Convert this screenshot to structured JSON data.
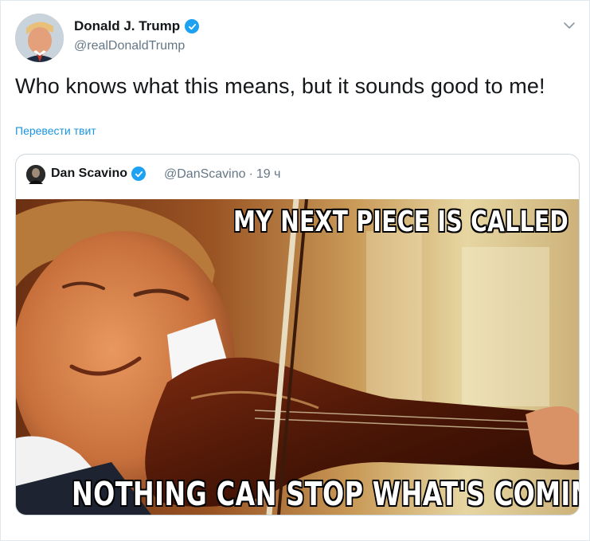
{
  "author": {
    "name": "Donald J. Trump",
    "handle": "@realDonaldTrump",
    "verified": true
  },
  "tweet": {
    "text": "Who knows what this means, but it sounds good to me!",
    "translate_label": "Перевести твит"
  },
  "menu": {
    "icon": "chevron-down-icon"
  },
  "quoted_tweet": {
    "name": "Dan Scavino",
    "handle": "@DanScavino",
    "separator": "·",
    "time": "19 ч",
    "verified": true,
    "media": {
      "top_text": "MY NEXT PIECE IS CALLED",
      "bottom_text": "NOTHING CAN STOP WHAT'S COMING"
    }
  },
  "colors": {
    "accent": "#1da1f2",
    "link": "#1b95e0",
    "secondary_text": "#657786",
    "primary_text": "#14171a",
    "border": "#ccd6dd"
  }
}
